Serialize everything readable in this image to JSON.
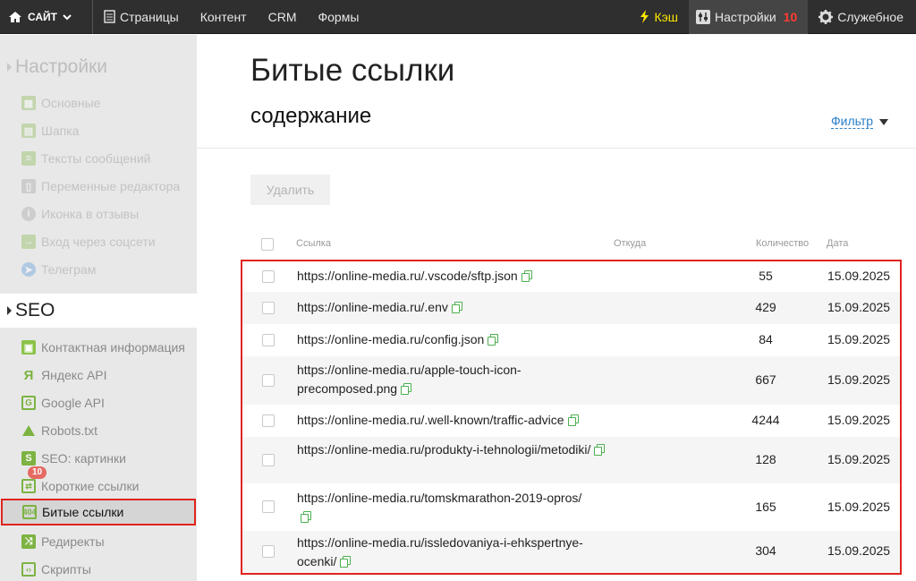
{
  "topbar": {
    "site_label": "САЙТ",
    "nav": [
      "Страницы",
      "Контент",
      "CRM",
      "Формы"
    ],
    "cache_label": "Кэш",
    "settings_label": "Настройки",
    "settings_count": "10",
    "service_label": "Служебное"
  },
  "sidebar": {
    "settings_heading": "Настройки",
    "settings_items": [
      {
        "label": "Основные",
        "icon": "grid-icon"
      },
      {
        "label": "Шапка",
        "icon": "header-icon"
      },
      {
        "label": "Тексты сообщений",
        "icon": "messages-icon"
      },
      {
        "label": "Переменные редактора",
        "icon": "document-icon"
      },
      {
        "label": "Иконка в отзывы",
        "icon": "info-icon"
      },
      {
        "label": "Вход через соцсети",
        "icon": "login-icon"
      },
      {
        "label": "Телеграм",
        "icon": "telegram-icon"
      }
    ],
    "seo_heading": "SEO",
    "seo_items": [
      {
        "label": "Контактная информация",
        "icon": "contacts-icon"
      },
      {
        "label": "Яндекс API",
        "icon": "yandex-icon"
      },
      {
        "label": "Google API",
        "icon": "google-icon"
      },
      {
        "label": "Robots.txt",
        "icon": "robots-icon"
      },
      {
        "label": "SEO: картинки",
        "icon": "images-icon"
      },
      {
        "label": "Короткие ссылки",
        "icon": "short-links-icon",
        "badge": "10"
      },
      {
        "label": "Битые ссылки",
        "icon": "broken-links-icon",
        "active": true
      },
      {
        "label": "Редиректы",
        "icon": "redirects-icon"
      },
      {
        "label": "Скрипты",
        "icon": "scripts-icon"
      }
    ]
  },
  "main": {
    "title": "Битые ссылки",
    "subtitle": "содержание",
    "filter_label": "Фильтр",
    "delete_button": "Удалить",
    "columns": {
      "link": "Ссылка",
      "source": "Откуда",
      "count": "Количество",
      "date": "Дата"
    },
    "rows": [
      {
        "link": "https://online-media.ru/.vscode/sftp.json",
        "count": "55",
        "date": "15.09.2025"
      },
      {
        "link": "https://online-media.ru/.env",
        "count": "429",
        "date": "15.09.2025"
      },
      {
        "link": "https://online-media.ru/config.json",
        "count": "84",
        "date": "15.09.2025"
      },
      {
        "link": "https://online-media.ru/apple-touch-icon-precomposed.png",
        "count": "667",
        "date": "15.09.2025"
      },
      {
        "link": "https://online-media.ru/.well-known/traffic-advice",
        "count": "4244",
        "date": "15.09.2025"
      },
      {
        "link": "https://online-media.ru/produkty-i-tehnologii/metodiki/",
        "count": "128",
        "date": "15.09.2025"
      },
      {
        "link": "https://online-media.ru/tomskmarathon-2019-opros/",
        "count": "165",
        "date": "15.09.2025"
      },
      {
        "link": "https://online-media.ru/issledovaniya-i-ehkspertnye-ocenki/",
        "count": "304",
        "date": "15.09.2025"
      }
    ]
  },
  "colors": {
    "accent_red": "#e0241f",
    "link_blue": "#2a7fc9",
    "icon_green": "#7cb342",
    "cache_yellow": "#ffe600"
  }
}
